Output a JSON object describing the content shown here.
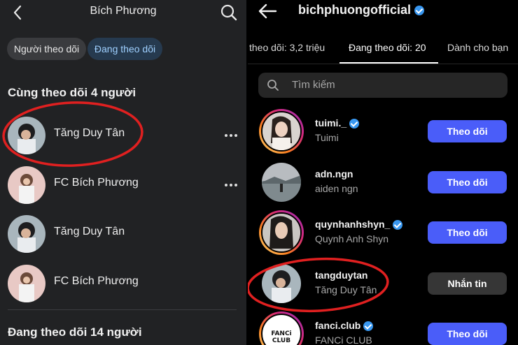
{
  "left": {
    "title": "Bích Phương",
    "tabs": [
      {
        "label": "Người theo dõi"
      },
      {
        "label": "Đang theo dõi"
      }
    ],
    "section_mutual": "Cùng theo dõi 4 người",
    "rows": [
      {
        "name": "Tăng Duy Tân",
        "more": true
      },
      {
        "name": "FC Bích Phương",
        "more": true
      },
      {
        "name": "Tăng Duy Tân",
        "more": false
      },
      {
        "name": "FC Bích Phương",
        "more": false
      }
    ],
    "section_following": "Đang theo dõi 14 người"
  },
  "right": {
    "username": "bichphuongofficial",
    "tabs": [
      {
        "label": "theo dõi: 3,2 triệu"
      },
      {
        "label": "Đang theo dõi: 20"
      },
      {
        "label": "Dành cho bạn"
      }
    ],
    "search_placeholder": "Tìm kiếm",
    "rows": [
      {
        "handle": "tuimi._",
        "fullname": "Tuimi",
        "verified": true,
        "button": "Theo dõi",
        "story": true
      },
      {
        "handle": "adn.ngn",
        "fullname": "aiden ngn",
        "verified": false,
        "button": "Theo dõi",
        "story": false
      },
      {
        "handle": "quynhanhshyn_",
        "fullname": "Quynh Anh Shyn",
        "verified": true,
        "button": "Theo dõi",
        "story": true
      },
      {
        "handle": "tangduytan",
        "fullname": "Tăng Duy Tân",
        "verified": false,
        "button": "Nhắn tin",
        "story": false
      },
      {
        "handle": "fanci.club",
        "fullname": "FANCi CLUB",
        "verified": true,
        "button": "Theo dõi",
        "story": true,
        "avatar_text": "FANCi CLUB"
      }
    ]
  },
  "colors": {
    "left_bg": "#212224",
    "right_bg": "#000000",
    "follow_button": "#4a5df9",
    "message_button": "#363636",
    "active_pill_text": "#9fd0ff",
    "annotation_red": "#e02020",
    "verified_badge": "#3897f0"
  }
}
